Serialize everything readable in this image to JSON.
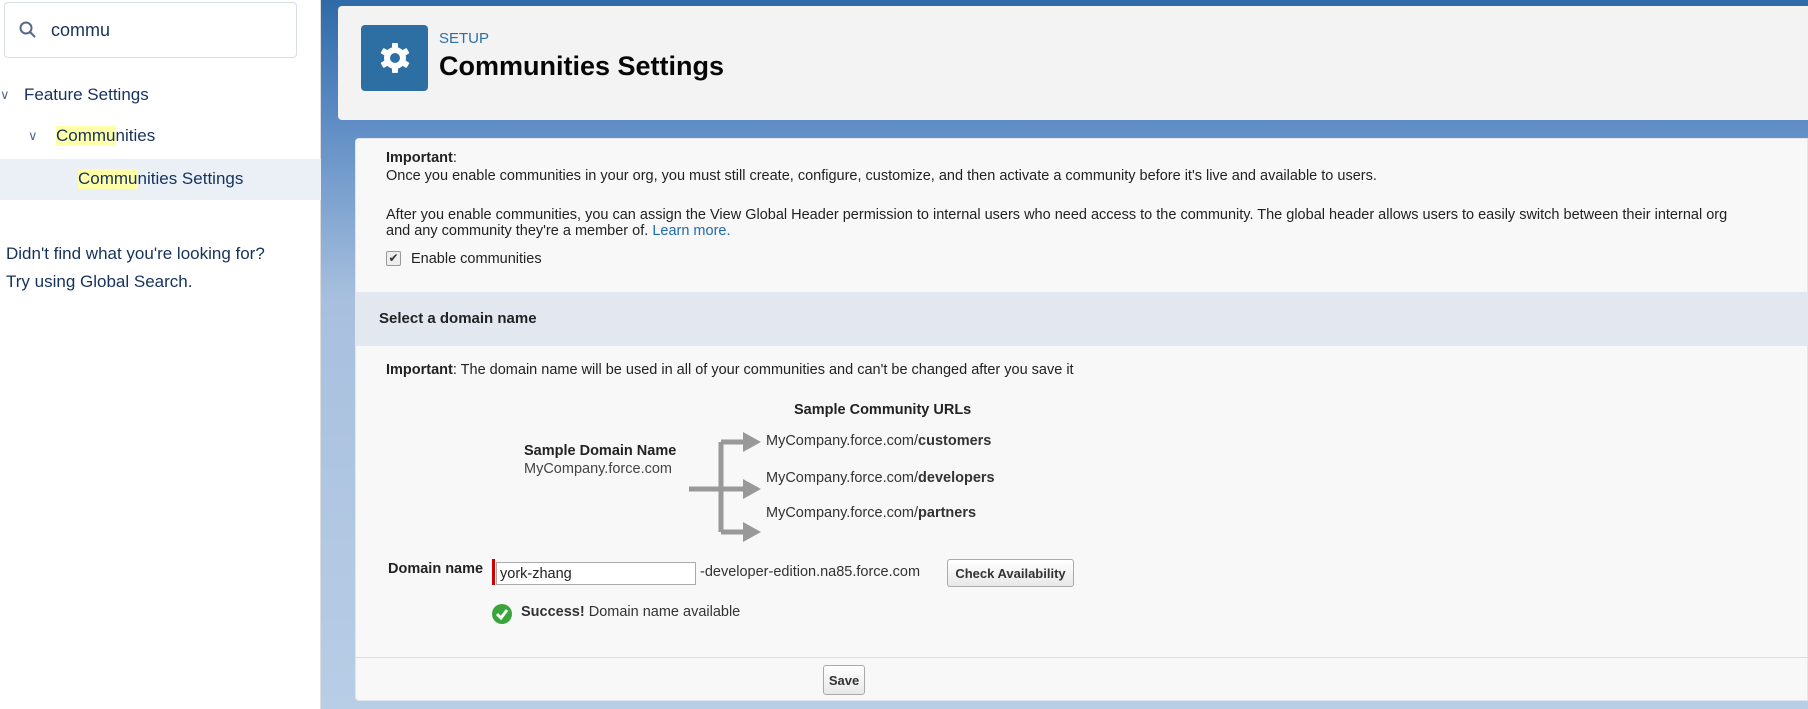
{
  "sidebar": {
    "search_value": "commu",
    "tree": [
      {
        "label": "Feature Settings",
        "level": 0,
        "expanded": true
      },
      {
        "label_highlight": "Commu",
        "label_rest": "nities",
        "level": 1,
        "expanded": true
      },
      {
        "label_highlight": "Commu",
        "label_rest": "nities Settings",
        "level": 2,
        "selected": true
      }
    ],
    "help_line1": "Didn't find what you're looking for?",
    "help_line2": "Try using Global Search."
  },
  "header": {
    "breadcrumb": "SETUP",
    "title": "Communities Settings",
    "icon": "gear-icon"
  },
  "intro": {
    "important_label": "Important",
    "line1": "Once you enable communities in your org, you must still create, configure, customize, and then activate a community before it's live and available to users.",
    "line2": "After you enable communities, you can assign the View Global Header permission to internal users who need access to the community. The global header allows users to easily switch between their internal org",
    "line3": "and any community they're a member of.",
    "learn_more": "Learn more.",
    "enable_label": "Enable communities",
    "enable_checked": true
  },
  "domain_section": {
    "title": "Select a domain name",
    "important_label": "Important",
    "important_text": ": The domain name will be used in all of your communities and can't be changed after you save it",
    "sample_urls_title": "Sample Community URLs",
    "sample_domain_title": "Sample Domain Name",
    "sample_domain": "MyCompany.force.com",
    "urls": [
      {
        "base": "MyCompany.force.com/",
        "path": "customers"
      },
      {
        "base": "MyCompany.force.com/",
        "path": "developers"
      },
      {
        "base": "MyCompany.force.com/",
        "path": "partners"
      }
    ],
    "domain_label": "Domain name",
    "domain_value": "york-zhang",
    "domain_suffix": "-developer-edition.na85.force.com",
    "check_button": "Check Availability",
    "success_strong": "Success!",
    "success_text": "Domain name available",
    "save_button": "Save"
  },
  "colors": {
    "accent": "#2e6fa3",
    "highlight": "#ffffa8",
    "success": "#3aa53a",
    "required": "#cc0000"
  }
}
